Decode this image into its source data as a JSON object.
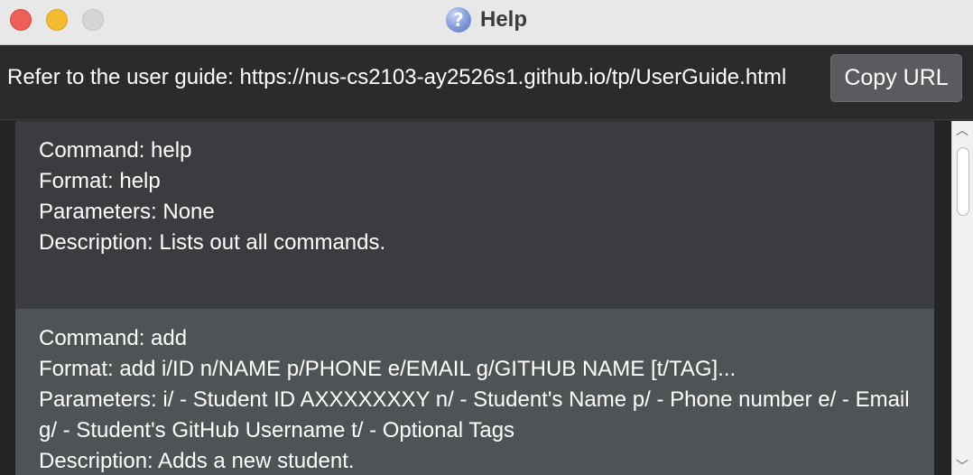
{
  "window": {
    "title": "Help",
    "icon": "help-question-icon"
  },
  "header": {
    "user_guide_text": "Refer to the user guide: https://nus-cs2103-ay2526s1.github.io/tp/UserGuide.html",
    "copy_button_label": "Copy URL"
  },
  "commands": [
    {
      "command": "Command: help",
      "format": "Format: help",
      "parameters": "Parameters: None",
      "description": "Description: Lists out all commands."
    },
    {
      "command": "Command: add",
      "format": "Format: add i/ID n/NAME p/PHONE e/EMAIL g/GITHUB NAME [t/TAG]...",
      "parameters": "Parameters: i/ - Student ID AXXXXXXXY  n/ - Student's Name p/ - Phone number e/ - Email",
      "parameters_cont": "g/ - Student's GitHub Username  t/ - Optional Tags",
      "description": "Description: Adds a new student."
    }
  ],
  "scroll": {
    "up_arrow": "︿",
    "down_arrow": "﹀"
  },
  "colors": {
    "row_odd": "#3b3c3f",
    "row_even": "#4e5455",
    "close": "#ee5f57",
    "minimize": "#f6bc2f"
  }
}
